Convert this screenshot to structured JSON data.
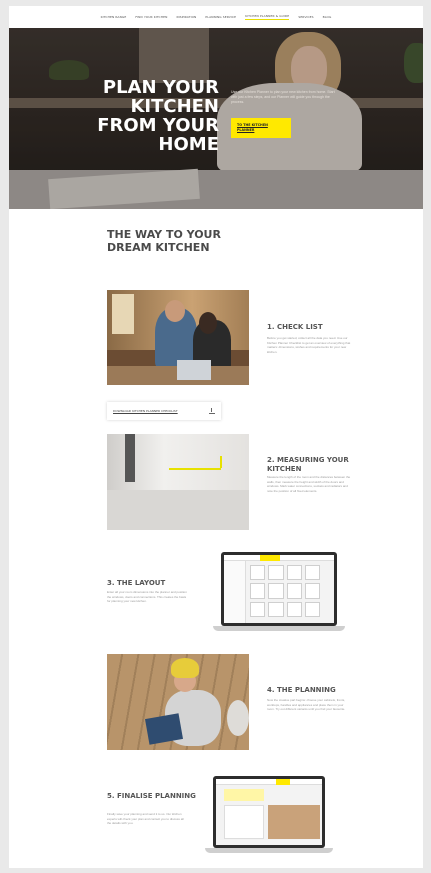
{
  "nav": {
    "items": [
      "Kitchen range",
      "Find your kitchen",
      "Inspiration",
      "Planning service",
      "Kitchen planner & guide",
      "Services",
      "Blog"
    ],
    "active_index": 4
  },
  "hero": {
    "title": "Plan your kitchen from your home",
    "text": "Use our Kitchen Planner to plan your new kitchen from home. Start with just a few steps, and our Planner will guide you through the process.",
    "button_label": "To the kitchen planner"
  },
  "section": {
    "title": "The way to your dream kitchen"
  },
  "steps": [
    {
      "title": "1. Check list",
      "text": "Before you get started, collect all the data you need. Use our Kitchen Planner Checklist to get an overview of everything that matters: dimensions, wishes and requirements for your new kitchen."
    },
    {
      "title": "2. Measuring your kitchen",
      "text": "Measure the length of the room and the distances between the walls, then measure the height and width of the doors and windows. Mark water connections, sockets and radiators and note the position of all fixed elements."
    },
    {
      "title": "3. The layout",
      "text": "Enter all your room dimensions into the planner and position the windows, doors and connections. This creates the basis for planning your new kitchen."
    },
    {
      "title": "4. The planning",
      "text": "Now the creative part begins: choose your cabinets, fronts, worktops, handles and appliances and place them in your room. Try out different variants until you find your favourite."
    },
    {
      "title": "5. Finalise planning",
      "text": "Finally save your planning and send it to us. Our kitchen experts will check your plan and contact you to discuss all the details with you."
    }
  ],
  "download": {
    "label": "Download kitchen planner checklist"
  },
  "icons": {
    "download": "download-icon"
  },
  "colors": {
    "accent": "#ffe900",
    "hero_bg": "#2c2622"
  }
}
